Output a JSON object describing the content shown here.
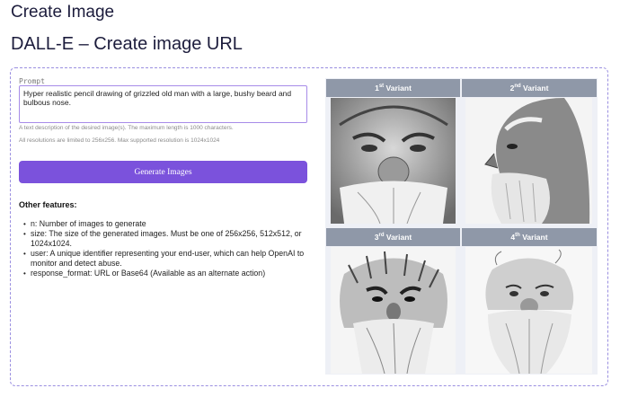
{
  "page": {
    "title": "Create Image",
    "section_title": "DALL-E – Create image URL"
  },
  "form": {
    "prompt_label": "Prompt",
    "prompt_value": "Hyper realistic pencil drawing of grizzled old man with a large, bushy beard and bulbous nose.",
    "hint_length": "A text description of the desired image(s). The maximum length is 1000 characters.",
    "hint_resolution": "All resolutions are limited to 256x256.  Max supported resolution is 1024x1024",
    "generate_label": "Generate Images"
  },
  "features": {
    "heading": "Other features:",
    "items": [
      "n: Number of images to generate",
      "size: The size of the generated images. Must be one of 256x256, 512x512, or 1024x1024.",
      "user: A unique identifier representing your end-user, which can help OpenAI to monitor and detect abuse.",
      "response_format: URL or Base64 (Available as an alternate action)"
    ]
  },
  "variants": [
    {
      "num": "1",
      "suffix": "st",
      "label": "Variant"
    },
    {
      "num": "2",
      "suffix": "nd",
      "label": "Variant"
    },
    {
      "num": "3",
      "suffix": "rd",
      "label": "Variant"
    },
    {
      "num": "4",
      "suffix": "th",
      "label": "Variant"
    }
  ],
  "colors": {
    "accent": "#7b52dc",
    "panel_border": "#9a8fe0",
    "variant_header": "#8f98a8"
  }
}
